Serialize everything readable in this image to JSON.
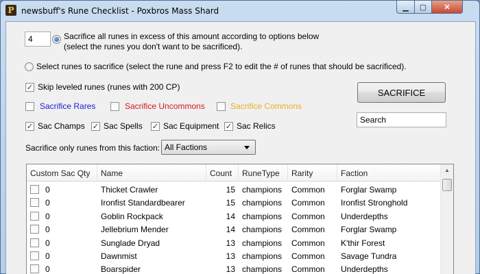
{
  "window": {
    "title": "newsbuff's Rune Checklist - Poxbros Mass Shard",
    "icon_glyph": "P",
    "minimize_glyph": "▁",
    "maximize_glyph": "▢",
    "close_glyph": "✕"
  },
  "options": {
    "excess_amount": "4",
    "excess_label_line1": "Sacrifice all runes in excess of this amount according to options below",
    "excess_label_line2": "(select the runes you don't want to be sacrificed).",
    "select_label": "Select runes to sacrifice (select the rune and press F2 to edit the # of runes that should be sacrificed).",
    "skip_leveled_label": "Skip leveled runes (runes with 200 CP)",
    "rares_label": "Sacrifice Rares",
    "uncommons_label": "Sacrifice Uncommons",
    "commons_label": "Sacrifice Commons",
    "sac_champs_label": "Sac Champs",
    "sac_spells_label": "Sac Spells",
    "sac_equipment_label": "Sac Equipment",
    "sac_relics_label": "Sac Relics",
    "faction_label": "Sacrifice only runes from this faction:",
    "faction_value": "All Factions"
  },
  "colors": {
    "rares": "#1a1ad6",
    "uncommons": "#d41a1a",
    "commons": "#e8b020"
  },
  "sacrifice_button": "SACRIFICE",
  "search_value": "Search",
  "table": {
    "columns": [
      "Custom Sac Qty",
      "Name",
      "Count",
      "RuneType",
      "Rarity",
      "Faction"
    ],
    "rows": [
      {
        "qty": "0",
        "name": "Thicket Crawler",
        "count": "15",
        "type": "champions",
        "rarity": "Common",
        "faction": "Forglar Swamp"
      },
      {
        "qty": "0",
        "name": "Ironfist Standardbearer",
        "count": "15",
        "type": "champions",
        "rarity": "Common",
        "faction": "Ironfist Stronghold"
      },
      {
        "qty": "0",
        "name": "Goblin Rockpack",
        "count": "14",
        "type": "champions",
        "rarity": "Common",
        "faction": "Underdepths"
      },
      {
        "qty": "0",
        "name": "Jellebrium Mender",
        "count": "14",
        "type": "champions",
        "rarity": "Common",
        "faction": "Forglar Swamp"
      },
      {
        "qty": "0",
        "name": "Sunglade Dryad",
        "count": "13",
        "type": "champions",
        "rarity": "Common",
        "faction": "K'thir Forest"
      },
      {
        "qty": "0",
        "name": "Dawnmist",
        "count": "13",
        "type": "champions",
        "rarity": "Common",
        "faction": "Savage Tundra"
      },
      {
        "qty": "0",
        "name": "Boarspider",
        "count": "13",
        "type": "champions",
        "rarity": "Common",
        "faction": "Underdepths"
      }
    ]
  },
  "icons": {
    "checkbox_checked": "✓",
    "scroll_up": "▲"
  }
}
